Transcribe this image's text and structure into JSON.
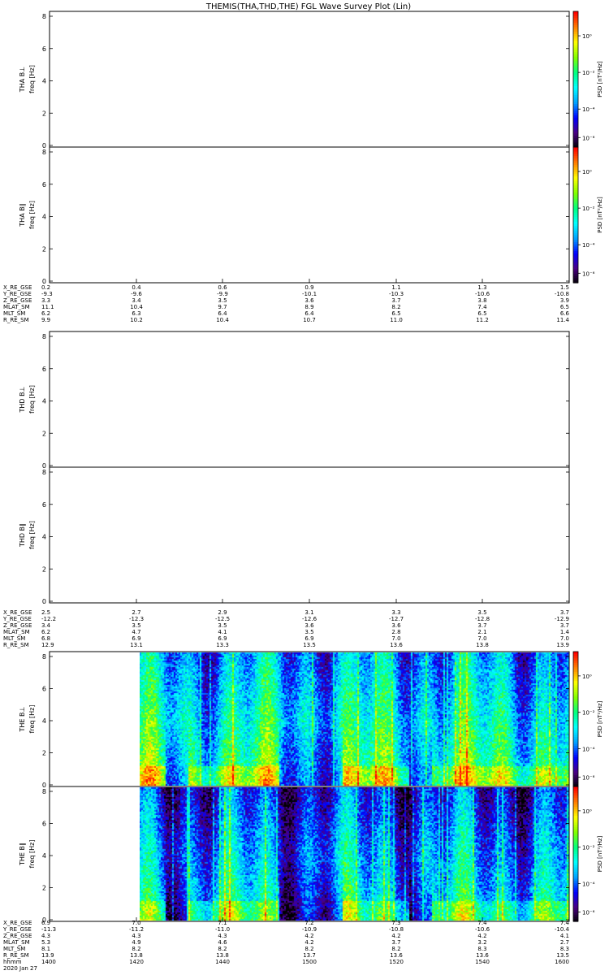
{
  "title": "THEMIS(THA,THD,THE) FGL Wave Survey Plot (Lin)",
  "colors": {
    "frame": "#000000",
    "background": "#ffffff"
  },
  "chart_data": [
    {
      "type": "heatmap",
      "probe": "THA",
      "panels": [
        {
          "component": "B⊥",
          "ylabel": "freq [Hz]",
          "ylim": [
            0,
            8
          ],
          "yticks": [
            "0",
            "2",
            "4",
            "6",
            "8"
          ],
          "cbar_label": "PSD [nT²/Hz]",
          "cbar_ticks": [
            "10⁰",
            "10⁻²",
            "10⁻⁴",
            "10⁻⁶"
          ],
          "has_data": false
        },
        {
          "component": "B∥",
          "ylabel": "freq [Hz]",
          "ylim": [
            0,
            8
          ],
          "yticks": [
            "0",
            "2",
            "4",
            "6",
            "8"
          ],
          "cbar_label": "PSD [nT²/Hz]",
          "cbar_ticks": [
            "10⁰",
            "10⁻²",
            "10⁻⁴",
            "10⁻⁶"
          ],
          "has_data": false
        }
      ],
      "ephemeris": {
        "labels": [
          "X_RE_GSE",
          "Y_RE_GSE",
          "Z_RE_GSE",
          "MLAT_SM",
          "MLT_SM",
          "R_RE_SM"
        ],
        "rows": [
          [
            "0.2",
            "0.4",
            "0.6",
            "0.9",
            "1.1",
            "1.3",
            "1.5"
          ],
          [
            "-9.3",
            "-9.6",
            "-9.9",
            "-10.1",
            "-10.3",
            "-10.6",
            "-10.8"
          ],
          [
            "3.3",
            "3.4",
            "3.5",
            "3.6",
            "3.7",
            "3.8",
            "3.9"
          ],
          [
            "11.1",
            "10.4",
            "9.7",
            "8.9",
            "8.2",
            "7.4",
            "6.5"
          ],
          [
            "6.2",
            "6.3",
            "6.4",
            "6.4",
            "6.5",
            "6.5",
            "6.6"
          ],
          [
            "9.9",
            "10.2",
            "10.4",
            "10.7",
            "11.0",
            "11.2",
            "11.4"
          ]
        ]
      }
    },
    {
      "type": "heatmap",
      "probe": "THD",
      "panels": [
        {
          "component": "B⊥",
          "ylabel": "freq [Hz]",
          "ylim": [
            0,
            8
          ],
          "yticks": [
            "0",
            "2",
            "4",
            "6",
            "8"
          ],
          "has_data": false
        },
        {
          "component": "B∥",
          "ylabel": "freq [Hz]",
          "ylim": [
            0,
            8
          ],
          "yticks": [
            "0",
            "2",
            "4",
            "6",
            "8"
          ],
          "has_data": false
        }
      ],
      "ephemeris": {
        "labels": [
          "X_RE_GSE",
          "Y_RE_GSE",
          "Z_RE_GSE",
          "MLAT_SM",
          "MLT_SM",
          "R_RE_SM"
        ],
        "rows": [
          [
            "2.5",
            "2.7",
            "2.9",
            "3.1",
            "3.3",
            "3.5",
            "3.7"
          ],
          [
            "-12.2",
            "-12.3",
            "-12.5",
            "-12.6",
            "-12.7",
            "-12.8",
            "-12.9"
          ],
          [
            "3.4",
            "3.5",
            "3.5",
            "3.6",
            "3.6",
            "3.7",
            "3.7"
          ],
          [
            "6.2",
            "4.7",
            "4.1",
            "3.5",
            "2.8",
            "2.1",
            "1.4"
          ],
          [
            "6.8",
            "6.9",
            "6.9",
            "6.9",
            "7.0",
            "7.0",
            "7.0"
          ],
          [
            "12.9",
            "13.1",
            "13.3",
            "13.5",
            "13.6",
            "13.8",
            "13.9"
          ]
        ]
      }
    },
    {
      "type": "heatmap",
      "probe": "THE",
      "panels": [
        {
          "component": "B⊥",
          "ylabel": "freq [Hz]",
          "ylim": [
            0,
            8
          ],
          "yticks": [
            "0",
            "2",
            "4",
            "6",
            "8"
          ],
          "cbar_label": "PSD [nT²/Hz]",
          "cbar_ticks": [
            "10⁰",
            "10⁻²",
            "10⁻⁴",
            "10⁻⁶"
          ],
          "has_data": true
        },
        {
          "component": "B∥",
          "ylabel": "freq [Hz]",
          "ylim": [
            0,
            8
          ],
          "yticks": [
            "0",
            "2",
            "4",
            "6",
            "8"
          ],
          "cbar_label": "PSD [nT²/Hz]",
          "cbar_ticks": [
            "10⁰",
            "10⁻²",
            "10⁻⁴",
            "10⁻⁶"
          ],
          "has_data": true
        }
      ],
      "xlim": [
        "2020-01-27 14:00",
        "2020-01-27 16:00"
      ],
      "data_start": "2020-01-27 14:04",
      "colormap": [
        "#000000",
        "#4b0082",
        "#0000ff",
        "#00a0ff",
        "#00ffff",
        "#00ff80",
        "#80ff00",
        "#ffff00",
        "#ff8000",
        "#ff0000"
      ],
      "ephemeris": {
        "labels": [
          "X_RE_GSE",
          "Y_RE_GSE",
          "Z_RE_GSE",
          "MLAT_SM",
          "MLT_SM",
          "R_RE_SM",
          "hhmm",
          "2020 Jan 27"
        ],
        "rows": [
          [
            "6.9",
            "7.0",
            "7.1",
            "7.2",
            "7.3",
            "7.4",
            "7.4"
          ],
          [
            "-11.3",
            "-11.2",
            "-11.0",
            "-10.9",
            "-10.8",
            "-10.6",
            "-10.4"
          ],
          [
            "4.3",
            "4.3",
            "4.3",
            "4.2",
            "4.2",
            "4.2",
            "4.1"
          ],
          [
            "5.3",
            "4.9",
            "4.6",
            "4.2",
            "3.7",
            "3.2",
            "2.7"
          ],
          [
            "8.1",
            "8.2",
            "8.2",
            "8.2",
            "8.2",
            "8.3",
            "8.3"
          ],
          [
            "13.9",
            "13.8",
            "13.8",
            "13.7",
            "13.6",
            "13.6",
            "13.5"
          ],
          [
            "1400",
            "1420",
            "1440",
            "1500",
            "1520",
            "1540",
            "1600"
          ]
        ]
      }
    }
  ]
}
